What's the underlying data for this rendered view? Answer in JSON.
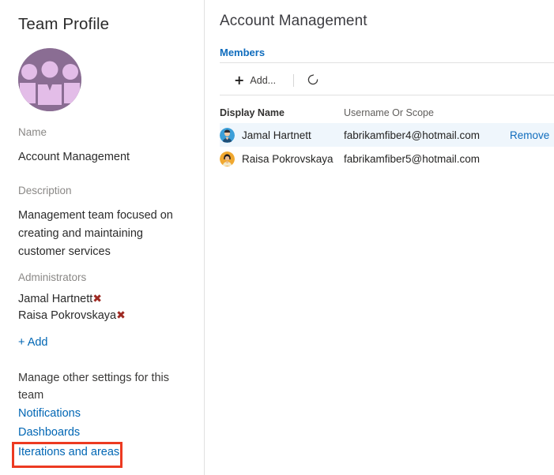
{
  "sidebar": {
    "title": "Team Profile",
    "avatar_icon": "team-group-avatar",
    "avatar_bg": "#8a6d93",
    "avatar_fg": "#e3bde8",
    "name_label": "Name",
    "name_value": "Account Management",
    "description_label": "Description",
    "description_value": "Management team focused on creating and maintaining customer services",
    "administrators_label": "Administrators",
    "administrators": [
      {
        "name": "Jamal Hartnett",
        "remove_icon": "x-remove-icon"
      },
      {
        "name": "Raisa Pokrovskaya",
        "remove_icon": "x-remove-icon"
      }
    ],
    "add_admin_label": "+ Add",
    "manage_note": "Manage other settings for this team",
    "settings_links": [
      {
        "label": "Notifications",
        "highlighted": false
      },
      {
        "label": "Dashboards",
        "highlighted": false
      },
      {
        "label": "Iterations and areas",
        "highlighted": true
      }
    ],
    "highlight_color": "#ec3a21",
    "link_color": "#0066b4",
    "remove_x_color": "#9e2a23"
  },
  "main": {
    "page_title": "Account Management",
    "tabs": [
      {
        "label": "Members",
        "active": true
      }
    ],
    "toolbar": {
      "add_label": "Add...",
      "add_icon": "plus-icon",
      "refresh_icon": "refresh-icon"
    },
    "table": {
      "columns": [
        "Display Name",
        "Username Or Scope",
        ""
      ],
      "rows": [
        {
          "avatar_icon": "user-avatar-blue",
          "display_name": "Jamal Hartnett",
          "username_or_scope": "fabrikamfiber4@hotmail.com",
          "action_label": "Remove",
          "selected": true
        },
        {
          "avatar_icon": "user-avatar-orange",
          "display_name": "Raisa Pokrovskaya",
          "username_or_scope": "fabrikamfiber5@hotmail.com",
          "action_label": "",
          "selected": false
        }
      ]
    },
    "accent_color": "#0f6cbd",
    "selected_row_bg": "#eff6fc"
  }
}
